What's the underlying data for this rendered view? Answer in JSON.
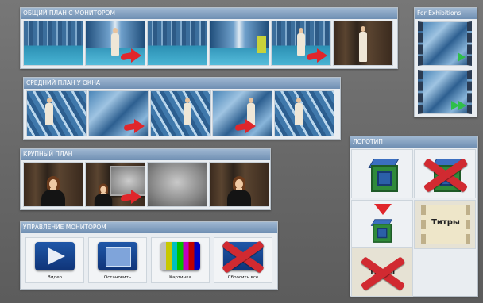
{
  "sections": {
    "general_plan": {
      "title": "ОБЩИЙ ПЛАН С МОНИТОРОМ"
    },
    "medium_plan": {
      "title": "СРЕДНИЙ ПЛАН У ОКНА"
    },
    "closeup": {
      "title": "КРУПНЫЙ ПЛАН"
    },
    "monitor_control": {
      "title": "УПРАВЛЕНИЕ МОНИТОРОМ",
      "buttons": [
        "Видео",
        "Остановить",
        "Картинка",
        "Сбросить все"
      ]
    },
    "exhibitions": {
      "title": "For Exhibitions"
    },
    "logo": {
      "title": "ЛОГОТИП",
      "titles_label": "Титры"
    }
  },
  "colors": {
    "header": "#7f9dbf",
    "arrow": "#e0262b",
    "button_blue": "#1f57a8",
    "cross": "#d12a31"
  }
}
